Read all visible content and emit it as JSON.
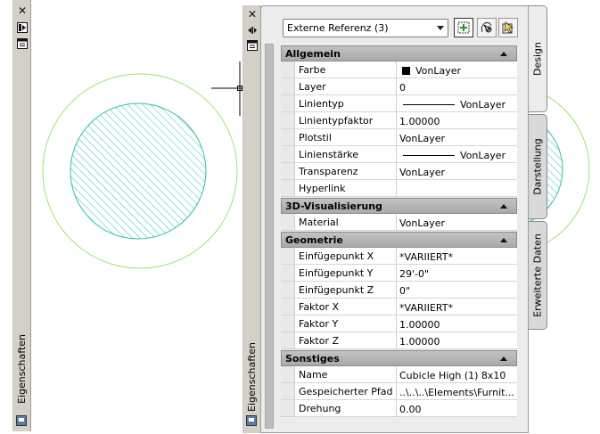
{
  "left_palette": {
    "title": "Eigenschaften"
  },
  "panel_strip": {
    "title": "Eigenschaften"
  },
  "selection": {
    "value": "Externe Referenz (3)"
  },
  "toolbar": {
    "icons": [
      "quick-select-icon",
      "select-objects-icon",
      "toggle-pickadd-icon"
    ]
  },
  "tabs": {
    "design": "Design",
    "darstellung": "Darstellung",
    "erweiterte": "Erweiterte Daten"
  },
  "categories": {
    "allgemein": "Allgemein",
    "visualisierung": "3D-Visualisierung",
    "geometrie": "Geometrie",
    "sonstiges": "Sonstiges"
  },
  "allgemein": [
    {
      "label": "Farbe",
      "value": "VonLayer"
    },
    {
      "label": "Layer",
      "value": "0"
    },
    {
      "label": "Linientyp",
      "value": "VonLayer"
    },
    {
      "label": "Linientypfaktor",
      "value": "1.00000"
    },
    {
      "label": "Plotstil",
      "value": "VonLayer"
    },
    {
      "label": "Linienstärke",
      "value": "VonLayer"
    },
    {
      "label": "Transparenz",
      "value": "VonLayer"
    },
    {
      "label": "Hyperlink",
      "value": ""
    }
  ],
  "visualisierung": [
    {
      "label": "Material",
      "value": "VonLayer"
    }
  ],
  "geometrie": [
    {
      "label": "Einfügepunkt X",
      "value": "*VARIIERT*"
    },
    {
      "label": "Einfügepunkt Y",
      "value": "29'-0\""
    },
    {
      "label": "Einfügepunkt Z",
      "value": "0\""
    },
    {
      "label": "Faktor X",
      "value": "*VARIIERT*"
    },
    {
      "label": "Faktor Y",
      "value": "1.00000"
    },
    {
      "label": "Faktor Z",
      "value": "1.00000"
    }
  ],
  "sonstiges": [
    {
      "label": "Name",
      "value": "Cubicle High (1) 8x10"
    },
    {
      "label": "Gespeicherter Pfad",
      "value": "..\\..\\..\\Elements\\Furnit..."
    },
    {
      "label": "Drehung",
      "value": "0.00"
    }
  ],
  "colors": {
    "circle_outer": "#99e36a",
    "circle_inner": "#2ec0a6",
    "hatch": "#2ec0b8",
    "panel_bg": "#ececec"
  }
}
